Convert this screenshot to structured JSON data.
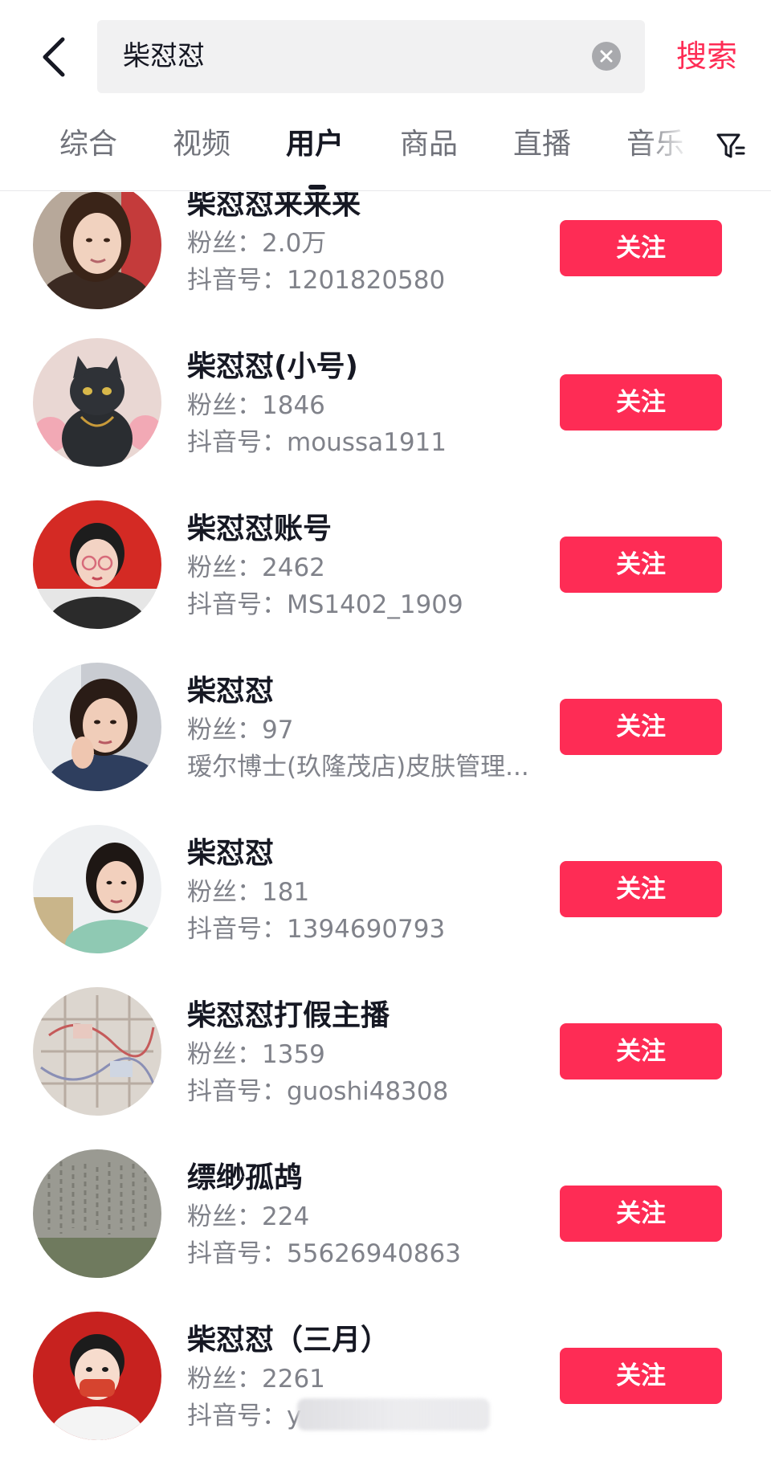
{
  "header": {
    "search_query": "柴怼怼",
    "search_button": "搜索"
  },
  "tabs": [
    {
      "label": "综合"
    },
    {
      "label": "视频"
    },
    {
      "label": "用户",
      "active": true
    },
    {
      "label": "商品"
    },
    {
      "label": "直播"
    },
    {
      "label": "音乐"
    }
  ],
  "labels": {
    "fans": "粉丝：",
    "douyin_id": "抖音号："
  },
  "users": [
    {
      "name": "柴怼怼来来来",
      "fans": "2.0万",
      "id": "1201820580",
      "follow": "关注",
      "avatar": "woman-portrait"
    },
    {
      "name": "柴怼怼(小号)",
      "fans": "1846",
      "id": "moussa1911",
      "follow": "关注",
      "avatar": "black-cat"
    },
    {
      "name": "柴怼怼账号",
      "fans": "2462",
      "id": "MS1402_1909",
      "follow": "关注",
      "avatar": "cartoon-girl-flag"
    },
    {
      "name": "柴怼怼",
      "fans": "97",
      "desc": "瑷尔博士(玖隆茂店)皮肤管理...",
      "follow": "关注",
      "avatar": "woman-selfie"
    },
    {
      "name": "柴怼怼",
      "fans": "181",
      "id": "1394690793",
      "follow": "关注",
      "avatar": "woman-office"
    },
    {
      "name": "柴怼怼打假主播",
      "fans": "1359",
      "id": "guoshi48308",
      "follow": "关注",
      "avatar": "map"
    },
    {
      "name": "缥缈孤鸪",
      "fans": "224",
      "id": "55626940863",
      "follow": "关注",
      "avatar": "stone-inscription"
    },
    {
      "name": "柴怼怼（三月）",
      "fans": "2261",
      "id": "y",
      "follow": "关注",
      "avatar": "cartoon-boy-mask"
    }
  ],
  "colors": {
    "accent": "#fe2c55",
    "text_primary": "#161823",
    "text_secondary": "#80828a"
  }
}
